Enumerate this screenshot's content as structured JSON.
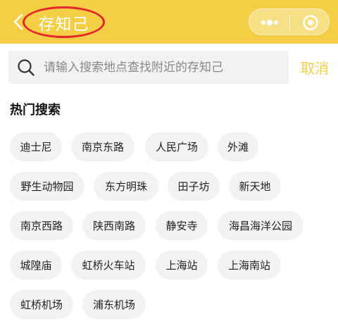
{
  "header": {
    "title": "存知己",
    "back_icon": "chevron-left-icon",
    "more_icon": "more-dots-icon",
    "close_icon": "target-close-icon",
    "colors": {
      "bar": "#f4cf45",
      "highlight": "#e5262b",
      "text": "#ffffff"
    }
  },
  "search": {
    "placeholder": "请输入搜索地点查找附近的存知己",
    "value": "",
    "cancel_label": "取消"
  },
  "hot": {
    "title": "热门搜索",
    "items": [
      "迪士尼",
      "南京东路",
      "人民广场",
      "外滩",
      "野生动物园",
      "东方明珠",
      "田子坊",
      "新天地",
      "南京西路",
      "陕西南路",
      "静安寺",
      "海昌海洋公园",
      "城隍庙",
      "虹桥火车站",
      "上海站",
      "上海南站",
      "虹桥机场",
      "浦东机场"
    ]
  }
}
